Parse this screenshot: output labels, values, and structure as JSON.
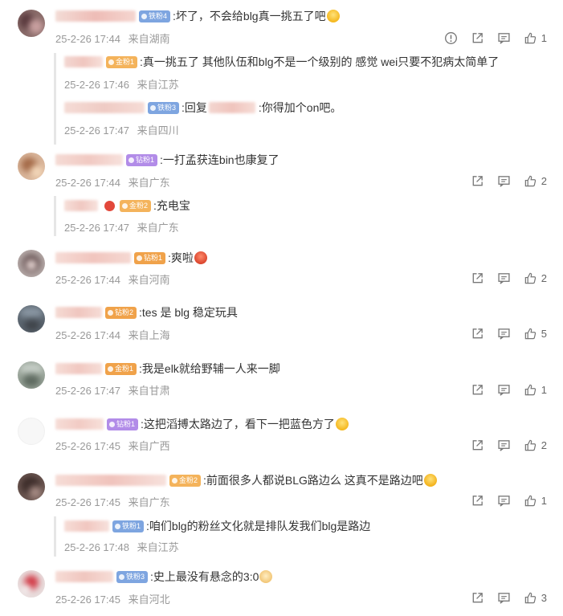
{
  "comments": [
    {
      "badge": "铁粉4",
      "text": ":坏了，不会给blg真一挑五了吧",
      "time": "25-2-26 17:44",
      "location": "来自湖南",
      "likes": "1",
      "replies": [
        {
          "badge": "金粉1",
          "text": ":真一挑五了 其他队伍和blg不是一个级别的 感觉 wei只要不犯病太简单了",
          "time": "25-2-26 17:46",
          "location": "来自江苏"
        },
        {
          "badge": "铁粉3",
          "reply_prefix": ":回复",
          "text": ":你得加个on吧。",
          "time": "25-2-26 17:47",
          "location": "来自四川"
        }
      ]
    },
    {
      "badge": "钻粉1",
      "text": ":一打孟获连bin也康复了",
      "time": "25-2-26 17:44",
      "location": "来自广东",
      "likes": "2",
      "replies": [
        {
          "badge": "金粉2",
          "text": ":充电宝",
          "time": "25-2-26 17:47",
          "location": "来自广东"
        }
      ]
    },
    {
      "badge": "钻粉1",
      "text": ":爽啦",
      "time": "25-2-26 17:44",
      "location": "来自河南",
      "likes": "2"
    },
    {
      "badge": "钻粉2",
      "text": ":tes 是 blg 稳定玩具",
      "time": "25-2-26 17:44",
      "location": "来自上海",
      "likes": "5"
    },
    {
      "badge": "金粉1",
      "text": ":我是elk就给野辅一人来一脚",
      "time": "25-2-26 17:47",
      "location": "来自甘肃",
      "likes": "1"
    },
    {
      "badge": "钻粉1",
      "text": ":这把滔搏太路边了，看下一把蓝色方了",
      "time": "25-2-26 17:45",
      "location": "来自广西",
      "likes": "2"
    },
    {
      "badge": "金粉2",
      "text": ":前面很多人都说BLG路边么 这真不是路边吧",
      "time": "25-2-26 17:45",
      "location": "来自广东",
      "likes": "1",
      "replies": [
        {
          "badge": "铁粉1",
          "text": ":咱们blg的粉丝文化就是排队发我们blg是路边",
          "time": "25-2-26 17:48",
          "location": "来自江苏"
        }
      ]
    },
    {
      "badge": "铁粉3",
      "text": ":史上最没有悬念的3:0",
      "time": "25-2-26 17:45",
      "location": "来自河北",
      "likes": "3"
    }
  ],
  "icons": {
    "report": "report-icon",
    "share": "share-icon",
    "comment": "comment-icon",
    "like": "thumbs-up-icon"
  },
  "colors": {
    "text": "#333333",
    "meta": "#999999",
    "iron_badge": "#7ea5e0",
    "gold_badge": "#f4b35b",
    "diamond_badge": "#b28ce8"
  }
}
